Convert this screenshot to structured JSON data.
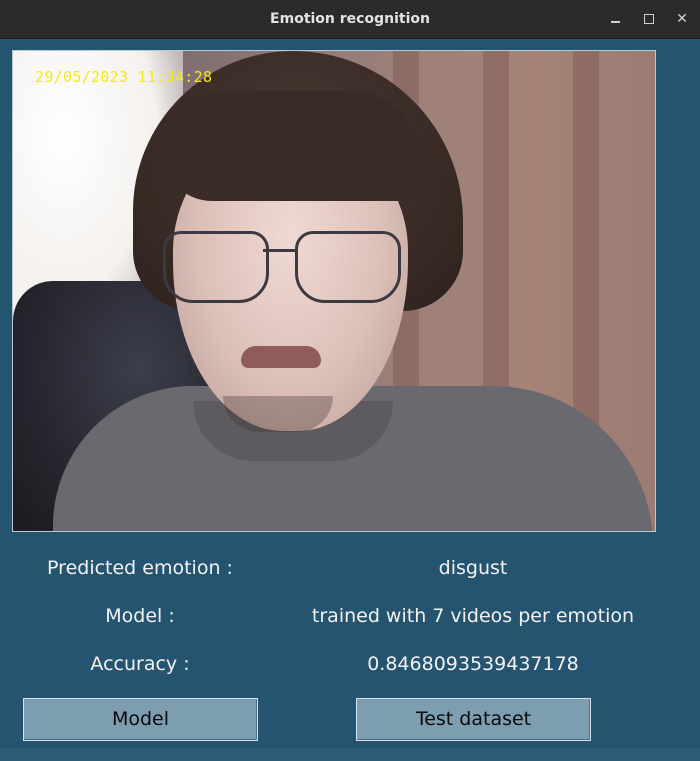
{
  "window": {
    "title": "Emotion recognition"
  },
  "feed": {
    "timestamp": "29/05/2023 11:34:28"
  },
  "info": {
    "emotion_label": "Predicted emotion :",
    "emotion_value": "disgust",
    "model_label": "Model :",
    "model_value": "trained with 7 videos per emotion",
    "accuracy_label": "Accuracy :",
    "accuracy_value": "0.8468093539437178"
  },
  "buttons": {
    "model": "Model",
    "test": "Test dataset"
  },
  "icons": {
    "minimize": "minimize-icon",
    "maximize": "maximize-icon",
    "close": "close-icon"
  },
  "colors": {
    "window_bg": "#245470",
    "button_bg": "#7d9db0",
    "timestamp": "#f2ea1a"
  }
}
